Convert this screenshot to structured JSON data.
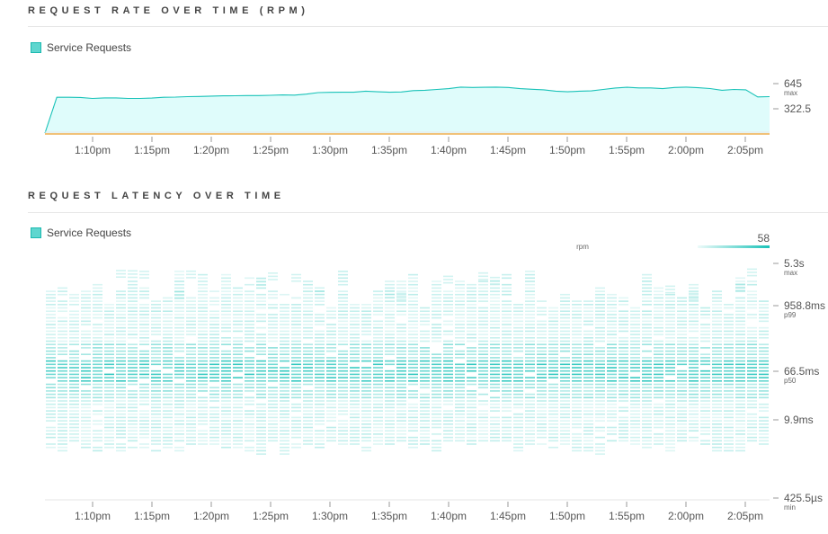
{
  "colors": {
    "accent": "#19c2b8",
    "area_fill": "#dffcfb",
    "baseline": "#f0c27a"
  },
  "rate_section": {
    "title": "REQUEST RATE OVER TIME (RPM)",
    "legend": "Service Requests"
  },
  "latency_section": {
    "title": "REQUEST LATENCY OVER TIME",
    "legend": "Service Requests"
  },
  "chart_data": [
    {
      "type": "area",
      "title": "REQUEST RATE OVER TIME (RPM)",
      "time_ticks": [
        "1:10pm",
        "1:15pm",
        "1:20pm",
        "1:25pm",
        "1:30pm",
        "1:35pm",
        "1:40pm",
        "1:45pm",
        "1:50pm",
        "1:55pm",
        "2:00pm",
        "2:05pm"
      ],
      "y_ticks": [
        {
          "label": "645",
          "sub": "max"
        },
        {
          "label": "322.5",
          "sub": ""
        }
      ],
      "ylim": [
        0,
        645
      ],
      "x_range": [
        "1:06pm",
        "2:06pm"
      ],
      "series": [
        {
          "name": "Service Requests",
          "values": [
            10,
            470,
            470,
            468,
            455,
            462,
            462,
            455,
            455,
            460,
            470,
            472,
            478,
            480,
            485,
            488,
            490,
            492,
            492,
            495,
            500,
            498,
            510,
            530,
            533,
            535,
            535,
            548,
            540,
            535,
            538,
            555,
            560,
            570,
            580,
            600,
            595,
            598,
            600,
            595,
            580,
            572,
            565,
            548,
            540,
            548,
            552,
            570,
            588,
            598,
            590,
            590,
            580,
            595,
            600,
            592,
            582,
            560,
            570,
            565,
            475,
            478
          ]
        }
      ]
    },
    {
      "type": "heatmap",
      "title": "REQUEST LATENCY OVER TIME",
      "time_ticks": [
        "1:10pm",
        "1:15pm",
        "1:20pm",
        "1:25pm",
        "1:30pm",
        "1:35pm",
        "1:40pm",
        "1:45pm",
        "1:50pm",
        "1:55pm",
        "2:00pm",
        "2:05pm"
      ],
      "y_ticks": [
        {
          "label": "5.3s",
          "sub": "max"
        },
        {
          "label": "958.8ms",
          "sub": "p99"
        },
        {
          "label": "66.5ms",
          "sub": "p50"
        },
        {
          "label": "9.9ms",
          "sub": ""
        },
        {
          "label": "425.5µs",
          "sub": "min"
        }
      ],
      "color_scale": {
        "label": "rpm",
        "max": "58",
        "max_value": 58
      },
      "series_name": "Service Requests",
      "columns": 62,
      "rows_per_column": 72
    }
  ]
}
